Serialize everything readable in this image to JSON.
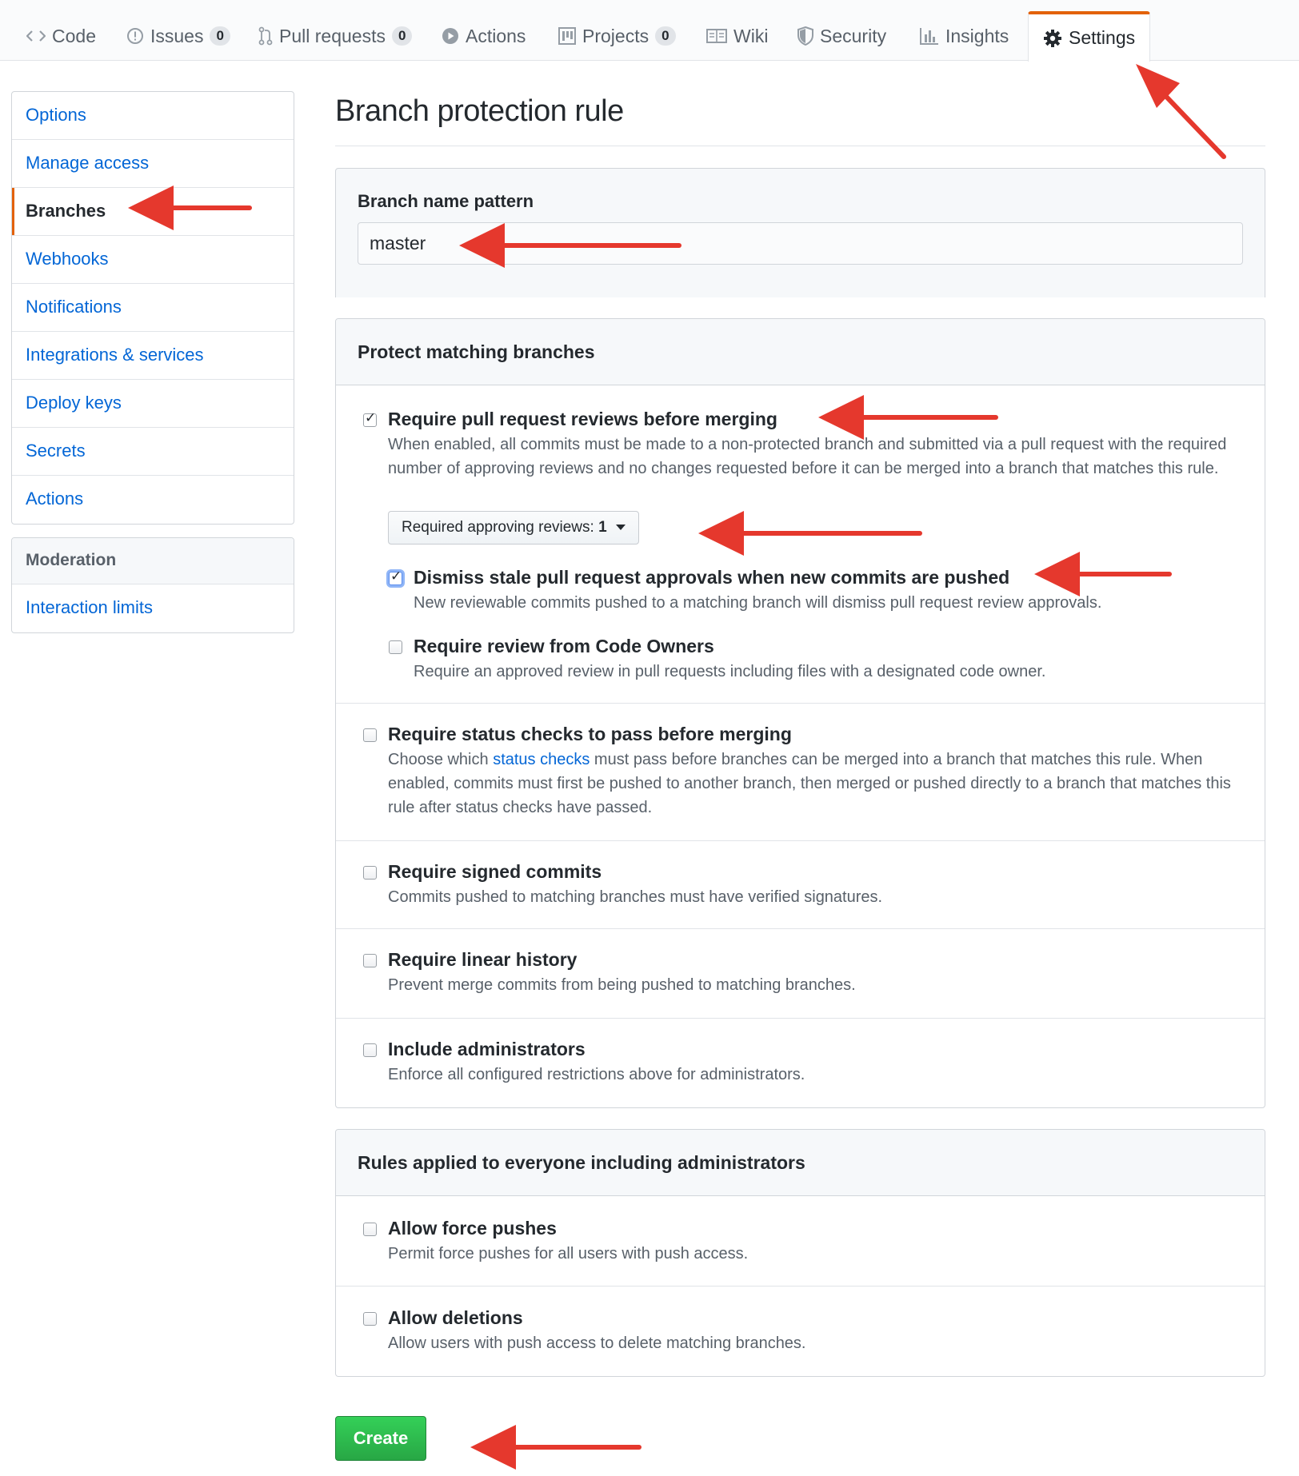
{
  "tabs": [
    {
      "label": "Code",
      "icon": "code-icon"
    },
    {
      "label": "Issues",
      "icon": "issue-opened-icon",
      "count": "0"
    },
    {
      "label": "Pull requests",
      "icon": "git-pull-request-icon",
      "count": "0"
    },
    {
      "label": "Actions",
      "icon": "play-icon"
    },
    {
      "label": "Projects",
      "icon": "project-icon",
      "count": "0"
    },
    {
      "label": "Wiki",
      "icon": "book-icon"
    },
    {
      "label": "Security",
      "icon": "shield-icon"
    },
    {
      "label": "Insights",
      "icon": "graph-icon"
    },
    {
      "label": "Settings",
      "icon": "gear-icon",
      "selected": true
    }
  ],
  "sidebar": {
    "items": [
      "Options",
      "Manage access",
      "Branches",
      "Webhooks",
      "Notifications",
      "Integrations & services",
      "Deploy keys",
      "Secrets",
      "Actions"
    ],
    "selected": "Branches",
    "moderation": {
      "heading": "Moderation",
      "items": [
        "Interaction limits"
      ]
    }
  },
  "page": {
    "title": "Branch protection rule"
  },
  "branch_pattern": {
    "label": "Branch name pattern",
    "value": "master"
  },
  "protect": {
    "heading": "Protect matching branches",
    "require_reviews": {
      "checked": true,
      "title": "Require pull request reviews before merging",
      "desc": "When enabled, all commits must be made to a non-protected branch and submitted via a pull request with the required number of approving reviews and no changes requested before it can be merged into a branch that matches this rule.",
      "select_label": "Required approving reviews:",
      "select_value": "1",
      "dismiss_stale": {
        "checked": true,
        "title": "Dismiss stale pull request approvals when new commits are pushed",
        "desc": "New reviewable commits pushed to a matching branch will dismiss pull request review approvals."
      },
      "code_owners": {
        "checked": false,
        "title": "Require review from Code Owners",
        "desc": "Require an approved review in pull requests including files with a designated code owner."
      }
    },
    "status_checks": {
      "checked": false,
      "title": "Require status checks to pass before merging",
      "desc_pre": "Choose which ",
      "desc_link": "status checks",
      "desc_post": " must pass before branches can be merged into a branch that matches this rule. When enabled, commits must first be pushed to another branch, then merged or pushed directly to a branch that matches this rule after status checks have passed."
    },
    "signed_commits": {
      "checked": false,
      "title": "Require signed commits",
      "desc": "Commits pushed to matching branches must have verified signatures."
    },
    "linear_history": {
      "checked": false,
      "title": "Require linear history",
      "desc": "Prevent merge commits from being pushed to matching branches."
    },
    "include_admins": {
      "checked": false,
      "title": "Include administrators",
      "desc": "Enforce all configured restrictions above for administrators."
    }
  },
  "everyone": {
    "heading": "Rules applied to everyone including administrators",
    "force_pushes": {
      "checked": false,
      "title": "Allow force pushes",
      "desc": "Permit force pushes for all users with push access."
    },
    "deletions": {
      "checked": false,
      "title": "Allow deletions",
      "desc": "Allow users with push access to delete matching branches."
    }
  },
  "actions": {
    "create_label": "Create"
  },
  "colors": {
    "link": "#0366d6",
    "accent": "#e36209",
    "create": "#28a745",
    "annotation_arrow": "#e5382d"
  }
}
